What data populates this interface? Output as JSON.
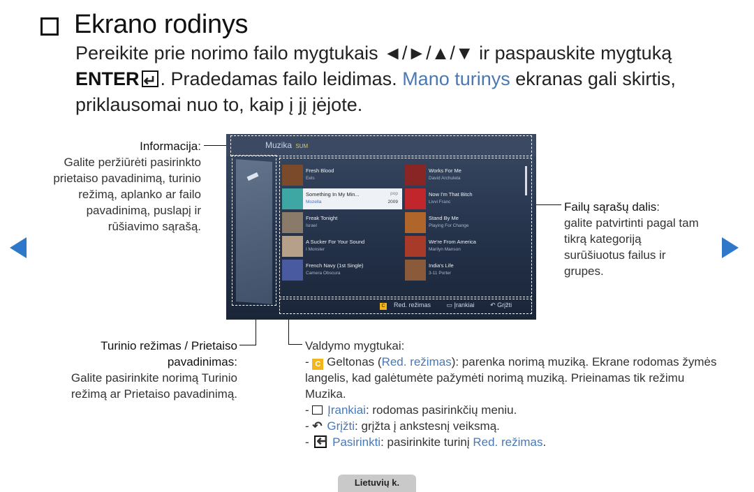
{
  "heading": {
    "title": "Ekrano rodinys"
  },
  "intro": {
    "part1": "Pereikite prie norimo failo mygtukais ◄/►/▲/▼ ir paspauskite mygtuką",
    "enter": "ENTER",
    "part2": ". Pradedamas failo leidimas. ",
    "link": "Mano turinys",
    "part3": " ekranas gali skirtis, priklausomai nuo to, kaip į jį įėjote."
  },
  "info_callout": {
    "label": "Informacija",
    "text": "Galite peržiūrėti pasirinkto prietaiso pavadinimą, turinio režimą, aplanko ar failo pavadinimą, puslapį ir rūšiavimo sąrašą."
  },
  "files_callout": {
    "label": "Failų sąrašų dalis",
    "text": "galite patvirtinti pagal tam tikrą kategoriją surūšiuotus failus ir grupes."
  },
  "mode_callout": {
    "label_line1": "Turinio režimas / Prietaiso",
    "label_line2": "pavadinimas",
    "text": "Galite pasirinkite norimą Turinio režimą ar Prietaiso pavadinimą."
  },
  "controls": {
    "label": "Valdymo mygtukai",
    "items": [
      {
        "badge": "C",
        "pre": "Geltonas (",
        "name": "Red. režimas",
        "desc": "): parenka norimą muziką. Ekrane rodomas žymės langelis, kad galėtumėte pažymėti norimą muziką. Prieinamas tik režimu Muzika."
      },
      {
        "name": "Įrankiai",
        "desc": ": rodomas pasirinkčių meniu."
      },
      {
        "name": "Grįžti",
        "desc": ": grįžta į ankstesnį veiksmą."
      },
      {
        "name": "Pasirinkti",
        "desc": ": pasirinkite turinį ",
        "name2": "Red. režimas",
        "tail": "."
      }
    ]
  },
  "tv": {
    "title": "Muzika",
    "subtitle": "SUM",
    "tracks": [
      {
        "title": "Fresh Blood",
        "artist": "Eels",
        "art": "#7a4a2b"
      },
      {
        "title": "Works For Me",
        "artist": "David Archuleta",
        "art": "#8a2525"
      },
      {
        "title": "Something In My Min...",
        "artist": "Mozella",
        "meta1": "pop",
        "meta2": "2009",
        "art": "#3fa7a3",
        "selected": true
      },
      {
        "title": "Now I'm That Bitch",
        "artist": "Livvi Franc",
        "art": "#c0262b"
      },
      {
        "title": "Freak Tonight",
        "artist": "Israel",
        "art": "#8a7a6a"
      },
      {
        "title": "Stand By Me",
        "artist": "Playing For Change",
        "art": "#b0662a"
      },
      {
        "title": "A Sucker For Your Sound",
        "artist": "I Monster",
        "art": "#b6a08a"
      },
      {
        "title": "We're From America",
        "artist": "Marilyn Manson",
        "art": "#a83a2a"
      },
      {
        "title": "French Navy (1st Single)",
        "artist": "Camera Obscura",
        "art": "#4a5aa0"
      },
      {
        "title": "India's Life",
        "artist": "3-11 Porter",
        "art": "#8a5a3a"
      }
    ],
    "ctrl_badge": "C",
    "ctrl_edit": "Red. režimas",
    "ctrl_tools": "Įrankiai",
    "ctrl_return": "Grįžti"
  },
  "lang_tab": "Lietuvių k."
}
